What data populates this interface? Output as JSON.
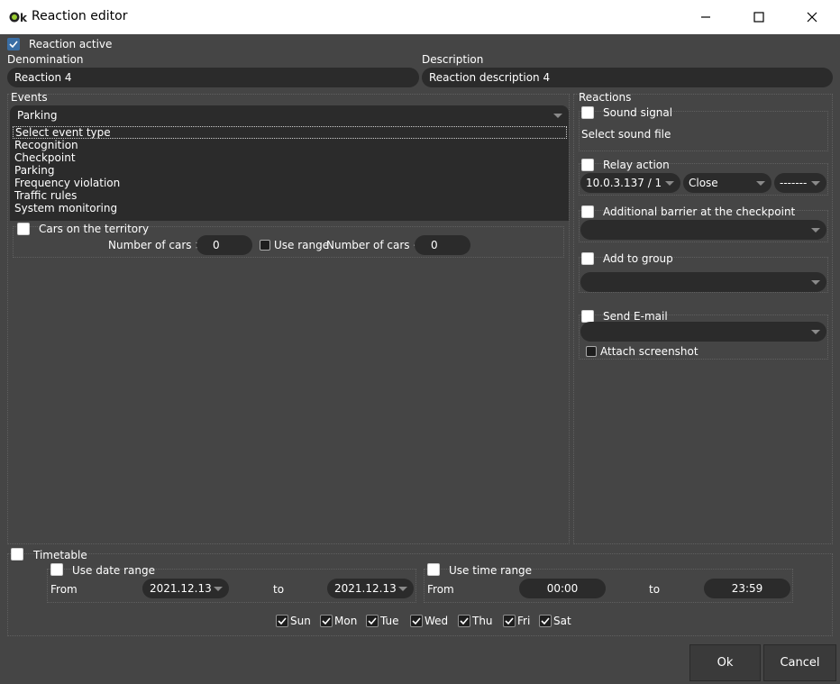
{
  "window": {
    "title": "Reaction editor",
    "minimize_icon": "minimize-icon",
    "maximize_icon": "maximize-icon",
    "close_icon": "close-icon"
  },
  "reaction_active": {
    "label": "Reaction active",
    "checked": true
  },
  "denomination": {
    "label": "Denomination",
    "value": "Reaction 4"
  },
  "description": {
    "label": "Description",
    "value": "Reaction description 4"
  },
  "events": {
    "label": "Events",
    "selected": "Parking",
    "options": [
      "Select event type",
      "Recognition",
      "Checkpoint",
      "Parking",
      "Frequency violation",
      "Traffic rules",
      "System monitoring"
    ],
    "cars_on_territory": {
      "label": "Cars on the territory",
      "checked": false
    },
    "number_of_cars_gt_label": "Number of cars >",
    "number_of_cars_gt_value": "0",
    "use_range_label": "Use range",
    "number_of_cars_lt_label": "Number of cars <",
    "number_of_cars_lt_value": "0"
  },
  "reactions": {
    "label": "Reactions",
    "sound_signal": {
      "label": "Sound signal",
      "checked": false,
      "file_label": "Select sound file"
    },
    "relay_action": {
      "label": "Relay action",
      "checked": false,
      "device": "10.0.3.137 / 1",
      "action": "Close",
      "extra": "-------"
    },
    "additional_barrier": {
      "label": "Additional barrier at the checkpoint",
      "checked": false,
      "value": ""
    },
    "add_to_group": {
      "label": "Add to group",
      "checked": false,
      "value": ""
    },
    "send_email": {
      "label": "Send E-mail",
      "checked": false,
      "value": ""
    },
    "attach_screenshot": {
      "label": "Attach screenshot",
      "checked": false
    }
  },
  "timetable": {
    "label": "Timetable",
    "checked": false,
    "use_date_range": {
      "label": "Use date range",
      "checked": false,
      "from_label": "From",
      "from": "2021.12.13",
      "to_label": "to",
      "to": "2021.12.13"
    },
    "use_time_range": {
      "label": "Use time range",
      "checked": false,
      "from_label": "From",
      "from": "00:00",
      "to_label": "to",
      "to": "23:59"
    },
    "days": [
      {
        "label": "Sun",
        "checked": true
      },
      {
        "label": "Mon",
        "checked": true
      },
      {
        "label": "Tue",
        "checked": true
      },
      {
        "label": "Wed",
        "checked": true
      },
      {
        "label": "Thu",
        "checked": true
      },
      {
        "label": "Fri",
        "checked": true
      },
      {
        "label": "Sat",
        "checked": true
      }
    ]
  },
  "buttons": {
    "ok": "Ok",
    "cancel": "Cancel"
  },
  "colors": {
    "background": "#454545",
    "field": "#2b2b2b",
    "accent": "#3a6ea5"
  }
}
